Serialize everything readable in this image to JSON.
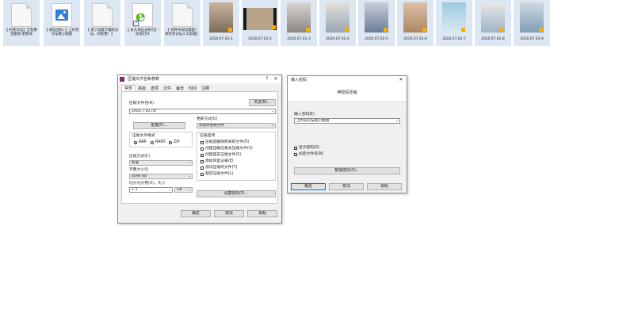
{
  "desktop": {
    "files": [
      {
        "label": "【 村花论坛】全免费-无删除-更新快",
        "kind": "doc"
      },
      {
        "label": "【 解压密码：】上村花论坛看小姐姐",
        "kind": "image"
      },
      {
        "label": "【 来了就能下载的论坛，纯免费！】",
        "kind": "doc"
      },
      {
        "label": "【 永久地址发布页】-防丢打开",
        "kind": "ie"
      },
      {
        "label": "【 有种子却没速度？来村花论坛人工加速】",
        "kind": "doc"
      }
    ],
    "videos": [
      {
        "label": "2020.07.02-1"
      },
      {
        "label": "2020.07.02-2"
      },
      {
        "label": "2020.07.02-3"
      },
      {
        "label": "2020.07.02-4"
      },
      {
        "label": "2020.07.02-5"
      },
      {
        "label": "2020.07.02-6"
      },
      {
        "label": "2020.07.02-7"
      },
      {
        "label": "2020.07.02-8"
      },
      {
        "label": "2020.07.02-9"
      }
    ]
  },
  "archive_dialog": {
    "title": "压缩文件名和参数",
    "help_glyph": "?",
    "close_glyph": "✕",
    "tabs": [
      "常规",
      "高级",
      "选项",
      "文件",
      "备份",
      "时间",
      "注释"
    ],
    "archive_name_label": "压缩文件名(A)",
    "browse_button": "浏览(B)...",
    "archive_name_value": "2020.7.02.rar",
    "profile_button": "配置(F)...",
    "update_mode_label": "更新方式(U)",
    "update_mode_value": "添加并替换文件",
    "format_label": "压缩文件格式",
    "formats": [
      "RAR",
      "RAR5",
      "ZIP"
    ],
    "method_label": "压缩方式(C)",
    "method_value": "标准",
    "dict_label": "字典大小(I)",
    "dict_value": "4096 KB",
    "split_label": "切分为分卷(V)，大小",
    "split_value": "1.3",
    "split_unit": "GB",
    "options_label": "压缩选项",
    "options": [
      "压缩后删除原来的文件(D)",
      "创建自解压格式压缩文件(X)",
      "创建固实压缩文件(S)",
      "添加恢复记录(E)",
      "测试压缩的文件(T)",
      "锁定压缩文件(L)"
    ],
    "set_password_button": "设置密码(P)...",
    "ok_button": "确定",
    "cancel_button": "取消",
    "help_button": "帮助"
  },
  "password_dialog": {
    "title": "输入密码",
    "close_glyph": "✕",
    "heading": "带密码压缩",
    "password_label": "输入密码(E)",
    "password_value": "上村花论坛看小姐姐",
    "show_password": "显示密码(S)",
    "encrypt_names": "加密文件名(N)",
    "manage_button": "整理密码(O)...",
    "ok_button": "确定",
    "cancel_button": "取消",
    "help_button": "帮助"
  },
  "colors": {
    "accent": "#0078d7",
    "desktop_selection": "#dde6f3",
    "ie_green": "#5bb31e"
  }
}
